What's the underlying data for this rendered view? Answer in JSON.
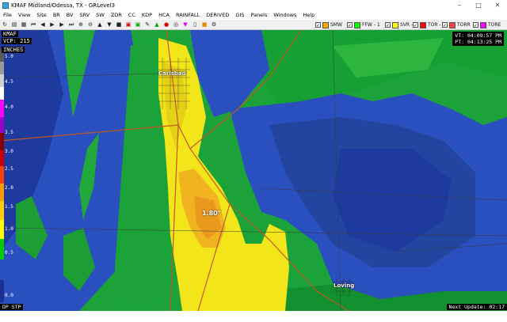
{
  "window": {
    "title": "KMAF Midland/Odessa, TX - GRLevel3",
    "minimize": "–",
    "maximize": "□",
    "close": "✕"
  },
  "menu": [
    "File",
    "View",
    "Site",
    "BR",
    "BV",
    "SRV",
    "SW",
    "ZDR",
    "CC",
    "KDP",
    "HCA",
    "RAINFALL",
    "DERIVED",
    "GIS",
    "Panels",
    "Windows",
    "Help"
  ],
  "warnings": [
    {
      "label": "SMW",
      "color": "#ffa500",
      "checked": true
    },
    {
      "label": "FFW - 1",
      "color": "#00ff00",
      "checked": true
    },
    {
      "label": "SVR - 6",
      "color": "#ffff00",
      "checked": true
    },
    {
      "label": "TOR - 2",
      "color": "#ff0000",
      "checked": true
    },
    {
      "label": "TORR",
      "color": "#ff4040",
      "checked": true
    },
    {
      "label": "TORE",
      "color": "#ff00ff",
      "checked": true
    }
  ],
  "radar": {
    "site": "KMAF",
    "vcp": "VCP: 215",
    "units": "INCHES",
    "product": "DP STP",
    "vt": "VT: 04:09:57 PM",
    "pt": "PT: 04:13:25 PM",
    "next_update": "Next Update: 02:17",
    "point_value": "1.80\"",
    "legend_ticks": [
      "5.0",
      "4.5",
      "4.0",
      "3.5",
      "3.0",
      "2.5",
      "2.0",
      "1.5",
      "1.0",
      "0.5",
      "0.0"
    ],
    "legend_colors": [
      "#5a5a5a",
      "#9a9a9a",
      "#d0d0d0",
      "#ffffff",
      "#ff00ff",
      "#9900cc",
      "#cc0000",
      "#ff4000",
      "#ff9900",
      "#ffcc00",
      "#ffff00",
      "#00cc00",
      "#1a8f2a",
      "#2a50c0",
      "#1a2f90"
    ]
  },
  "cities": [
    {
      "name": "Carlsbad"
    },
    {
      "name": "Loving"
    }
  ]
}
